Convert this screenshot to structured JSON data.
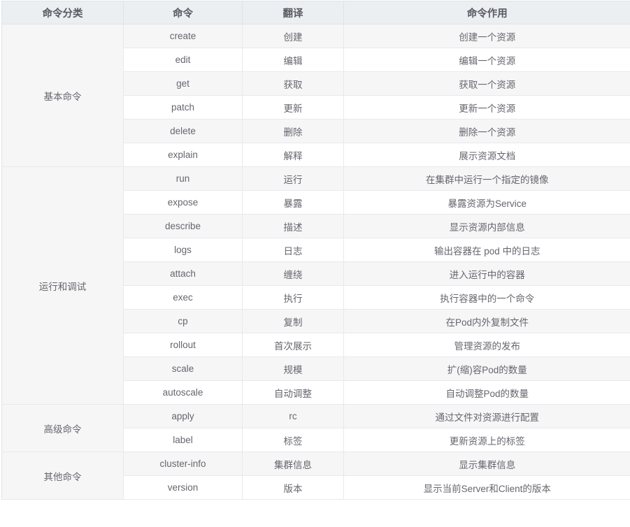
{
  "table": {
    "headers": [
      {
        "label": "命令分类",
        "key": "category"
      },
      {
        "label": "命令",
        "key": "command"
      },
      {
        "label": "翻译",
        "key": "translation"
      },
      {
        "label": "命令作用",
        "key": "description"
      }
    ],
    "groups": [
      {
        "category": "基本命令",
        "rows": [
          {
            "command": "create",
            "translation": "创建",
            "description": "创建一个资源"
          },
          {
            "command": "edit",
            "translation": "编辑",
            "description": "编辑一个资源"
          },
          {
            "command": "get",
            "translation": "获取",
            "description": "获取一个资源"
          },
          {
            "command": "patch",
            "translation": "更新",
            "description": "更新一个资源"
          },
          {
            "command": "delete",
            "translation": "删除",
            "description": "删除一个资源"
          },
          {
            "command": "explain",
            "translation": "解释",
            "description": "展示资源文档"
          }
        ]
      },
      {
        "category": "运行和调试",
        "rows": [
          {
            "command": "run",
            "translation": "运行",
            "description": "在集群中运行一个指定的镜像"
          },
          {
            "command": "expose",
            "translation": "暴露",
            "description": "暴露资源为Service"
          },
          {
            "command": "describe",
            "translation": "描述",
            "description": "显示资源内部信息"
          },
          {
            "command": "logs",
            "translation": "日志",
            "description": "输出容器在 pod 中的日志"
          },
          {
            "command": "attach",
            "translation": "缠绕",
            "description": "进入运行中的容器"
          },
          {
            "command": "exec",
            "translation": "执行",
            "description": "执行容器中的一个命令"
          },
          {
            "command": "cp",
            "translation": "复制",
            "description": "在Pod内外复制文件"
          },
          {
            "command": "rollout",
            "translation": "首次展示",
            "description": "管理资源的发布"
          },
          {
            "command": "scale",
            "translation": "规模",
            "description": "扩(缩)容Pod的数量"
          },
          {
            "command": "autoscale",
            "translation": "自动调整",
            "description": "自动调整Pod的数量"
          }
        ]
      },
      {
        "category": "高级命令",
        "rows": [
          {
            "command": "apply",
            "translation": "rc",
            "description": "通过文件对资源进行配置"
          },
          {
            "command": "label",
            "translation": "标签",
            "description": "更新资源上的标签"
          }
        ]
      },
      {
        "category": "其他命令",
        "rows": [
          {
            "command": "cluster-info",
            "translation": "集群信息",
            "description": "显示集群信息"
          },
          {
            "command": "version",
            "translation": "版本",
            "description": "显示当前Server和Client的版本"
          }
        ]
      }
    ]
  },
  "colors": {
    "header_bg": "#eceff1",
    "header_text": "#5a5a63",
    "body_text": "#66666e",
    "row_stripe": "#f6f6f7",
    "row_plain": "#ffffff",
    "border": "#e6e9eb"
  }
}
